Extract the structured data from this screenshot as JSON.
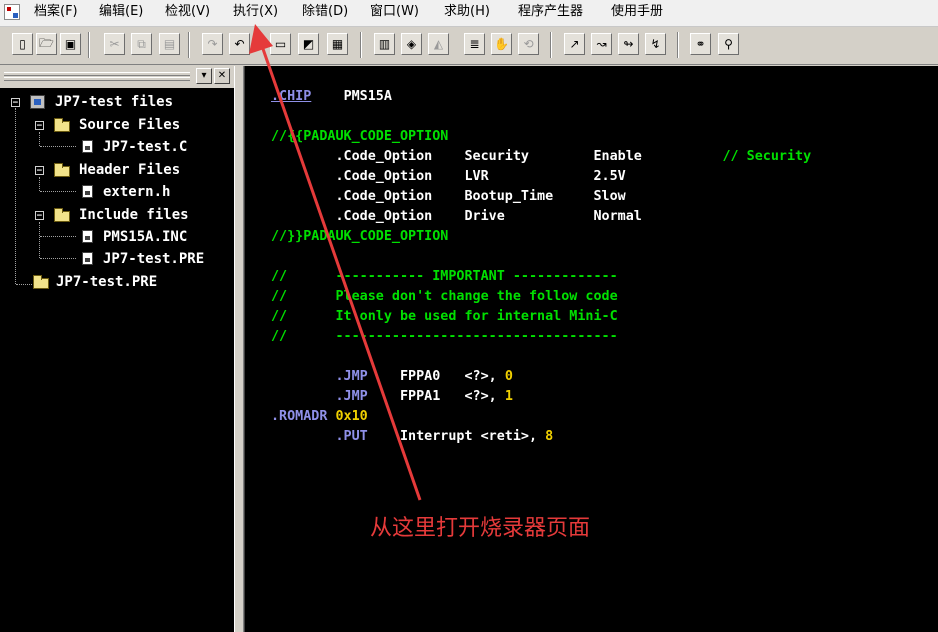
{
  "menubar": {
    "items": [
      "档案(F)",
      "编辑(E)",
      "检视(V)",
      "执行(X)",
      "除错(D)",
      "窗口(W)",
      "求助(H)",
      "程序产生器",
      "使用手册"
    ]
  },
  "toolbar": {
    "buttons": [
      {
        "name": "new-file-button",
        "glyph": "▯"
      },
      {
        "name": "open-folder-button",
        "glyph": "🗁"
      },
      {
        "name": "save-button",
        "glyph": "▣"
      },
      {
        "name": "cut-button",
        "glyph": "✂"
      },
      {
        "name": "copy-button",
        "glyph": "⧉"
      },
      {
        "name": "paste-button",
        "glyph": "▤"
      },
      {
        "name": "redo-button",
        "glyph": "↷"
      },
      {
        "name": "undo-button",
        "glyph": "↶"
      },
      {
        "name": "window-button",
        "glyph": "▭"
      },
      {
        "name": "image-button",
        "glyph": "◩"
      },
      {
        "name": "chip-button",
        "glyph": "▦"
      },
      {
        "name": "build-button",
        "glyph": "▥"
      },
      {
        "name": "compile-button",
        "glyph": "◈"
      },
      {
        "name": "erase-button",
        "glyph": "◭"
      },
      {
        "name": "list-button",
        "glyph": "≣"
      },
      {
        "name": "stop-button",
        "glyph": "✋"
      },
      {
        "name": "reset-button",
        "glyph": "⟲"
      },
      {
        "name": "step-into-button",
        "glyph": "↗"
      },
      {
        "name": "step-over-button",
        "glyph": "↝"
      },
      {
        "name": "step-out-button",
        "glyph": "↬"
      },
      {
        "name": "run-to-cursor-button",
        "glyph": "↯"
      },
      {
        "name": "find-button",
        "glyph": "⚭"
      },
      {
        "name": "find-replace-button",
        "glyph": "⚲"
      }
    ]
  },
  "tree": {
    "root": "JP7-test files",
    "source_folder": "Source Files",
    "source_file": "JP7-test.C",
    "header_folder": "Header Files",
    "header_file": "extern.h",
    "include_folder": "Include files",
    "include_file_1": "PMS15A.INC",
    "include_file_2": "JP7-test.PRE",
    "extra_file": "JP7-test.PRE"
  },
  "code": {
    "l1_dir": ".CHIP",
    "l1_val": "PMS15A",
    "l2": "//{{PADAUK_CODE_OPTION",
    "opt1": {
      "dir": ".Code_Option",
      "name": "Security",
      "value": "Enable",
      "comment": "// Security"
    },
    "opt2": {
      "dir": ".Code_Option",
      "name": "LVR",
      "value": "2.5V"
    },
    "opt3": {
      "dir": ".Code_Option",
      "name": "Bootup_Time",
      "value": "Slow"
    },
    "opt4": {
      "dir": ".Code_Option",
      "name": "Drive",
      "value": "Normal"
    },
    "l7": "//}}PADAUK_CODE_OPTION",
    "c1": "//      ----------- IMPORTANT -------------",
    "c2": "//      Please don't change the follow code",
    "c3": "//      It only be used for internal Mini-C",
    "c4": "//      -----------------------------------",
    "jmp1": {
      "dir": ".JMP",
      "label": "FPPA0",
      "arg": "<?>,",
      "num": "0"
    },
    "jmp2": {
      "dir": ".JMP",
      "label": "FPPA1",
      "arg": "<?>,",
      "num": "1"
    },
    "romadr": {
      "dir": ".ROMADR",
      "val": "0x10"
    },
    "put": {
      "dir": ".PUT",
      "arg": "Interrupt <reti>,",
      "num": "8"
    }
  },
  "annotation": {
    "text": "从这里打开烧录器页面",
    "color": "#e53a3a"
  }
}
